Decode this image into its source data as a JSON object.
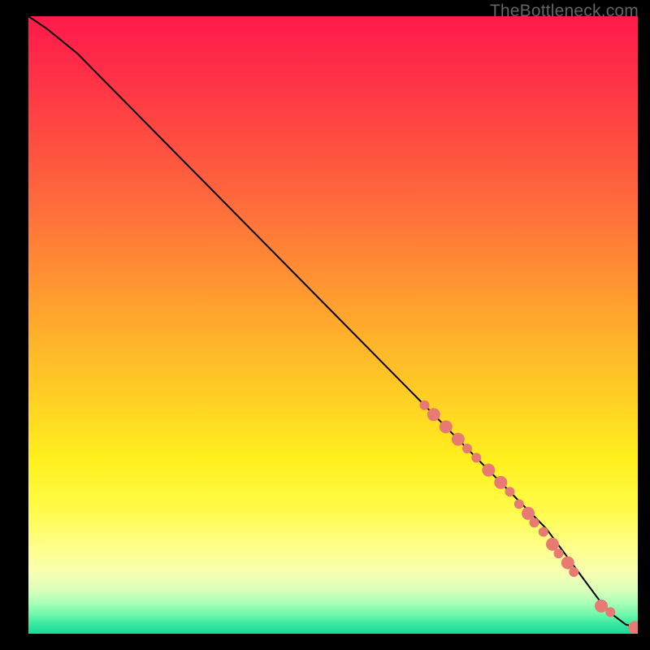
{
  "watermark": "TheBottleneck.com",
  "chart_data": {
    "type": "line",
    "title": "",
    "xlabel": "",
    "ylabel": "",
    "xlim": [
      0,
      100
    ],
    "ylim": [
      0,
      100
    ],
    "grid": false,
    "legend": false,
    "gradient_stops": [
      {
        "pos": 0,
        "color": "#ff1a4a"
      },
      {
        "pos": 50,
        "color": "#ffab2c"
      },
      {
        "pos": 80,
        "color": "#fffb4a"
      },
      {
        "pos": 97,
        "color": "#6cf7ab"
      },
      {
        "pos": 100,
        "color": "#18da97"
      }
    ],
    "series": [
      {
        "name": "bottleneck-curve",
        "x": [
          0,
          3,
          8,
          15,
          25,
          35,
          45,
          55,
          65,
          70,
          75,
          80,
          85,
          88,
          91,
          94,
          96,
          98,
          100
        ],
        "y": [
          100,
          98,
          94,
          87,
          77,
          67,
          57,
          47,
          37,
          32,
          27,
          22,
          17,
          13,
          9,
          5,
          3,
          1.5,
          1
        ]
      }
    ],
    "scatter_points": {
      "name": "measured-datapoints",
      "points": [
        {
          "x": 65.0,
          "y": 37.0,
          "r": 6
        },
        {
          "x": 66.5,
          "y": 35.5,
          "r": 8
        },
        {
          "x": 68.5,
          "y": 33.5,
          "r": 8
        },
        {
          "x": 70.5,
          "y": 31.5,
          "r": 8
        },
        {
          "x": 72.0,
          "y": 30.0,
          "r": 6
        },
        {
          "x": 73.5,
          "y": 28.5,
          "r": 6
        },
        {
          "x": 75.5,
          "y": 26.5,
          "r": 8
        },
        {
          "x": 77.5,
          "y": 24.5,
          "r": 8
        },
        {
          "x": 79.0,
          "y": 23.0,
          "r": 6
        },
        {
          "x": 80.5,
          "y": 21.0,
          "r": 6
        },
        {
          "x": 82.0,
          "y": 19.5,
          "r": 8
        },
        {
          "x": 83.0,
          "y": 18.0,
          "r": 6
        },
        {
          "x": 84.5,
          "y": 16.5,
          "r": 6
        },
        {
          "x": 86.0,
          "y": 14.5,
          "r": 8
        },
        {
          "x": 87.0,
          "y": 13.0,
          "r": 6
        },
        {
          "x": 88.5,
          "y": 11.5,
          "r": 8
        },
        {
          "x": 89.5,
          "y": 10.0,
          "r": 6
        },
        {
          "x": 94.0,
          "y": 4.5,
          "r": 8
        },
        {
          "x": 95.5,
          "y": 3.5,
          "r": 6
        },
        {
          "x": 99.5,
          "y": 1.0,
          "r": 8
        }
      ]
    }
  }
}
